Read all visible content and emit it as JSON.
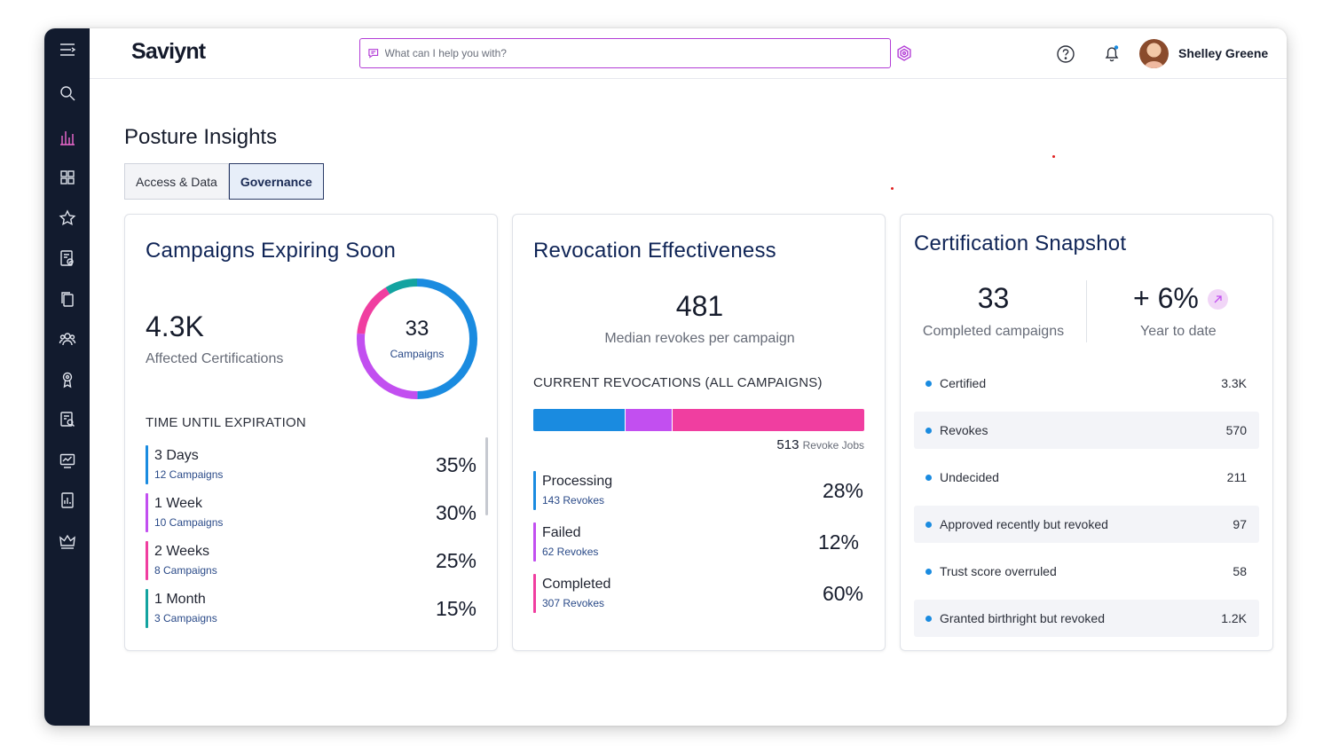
{
  "header": {
    "logo": "Saviynt",
    "search_placeholder": "What can I help you with?",
    "user_name": "Shelley Greene"
  },
  "sidebar": {
    "icons": [
      "menu-icon",
      "search-icon",
      "analytics-icon",
      "dashboard-icon",
      "star-icon",
      "certification-icon",
      "copy-icon",
      "users-icon",
      "award-icon",
      "request-icon",
      "monitor-icon",
      "report-icon",
      "crown-icon"
    ]
  },
  "page": {
    "title": "Posture Insights",
    "tabs": [
      {
        "label": "Access & Data",
        "active": false
      },
      {
        "label": "Governance",
        "active": true
      }
    ]
  },
  "campaigns": {
    "title": "Campaigns Expiring Soon",
    "affected_value": "4.3K",
    "affected_label": "Affected Certifications",
    "donut_value": "33",
    "donut_label": "Campaigns",
    "section_label": "TIME UNTIL EXPIRATION",
    "rows": [
      {
        "label": "3 Days",
        "sub": "12 Campaigns",
        "pct": "35%",
        "color": "#1a8be0"
      },
      {
        "label": "1 Week",
        "sub": "10 Campaigns",
        "pct": "30%",
        "color": "#c24ff0"
      },
      {
        "label": "2 Weeks",
        "sub": "8 Campaigns",
        "pct": "25%",
        "color": "#f03ea0"
      },
      {
        "label": "1 Month",
        "sub": "3 Campaigns",
        "pct": "15%",
        "color": "#13a3a0"
      }
    ]
  },
  "revocation": {
    "title": "Revocation Effectiveness",
    "median_value": "481",
    "median_label": "Median revokes per campaign",
    "section_label": "CURRENT REVOCATIONS (ALL CAMPAIGNS)",
    "jobs_value": "513",
    "jobs_label": "Revoke Jobs",
    "rows": [
      {
        "label": "Processing",
        "sub": "143 Revokes",
        "pct": "28%",
        "color": "#1a8be0"
      },
      {
        "label": "Failed",
        "sub": "62 Revokes",
        "pct": "12%",
        "color": "#c24ff0"
      },
      {
        "label": "Completed",
        "sub": "307 Revokes",
        "pct": "60%",
        "color": "#f03ea0"
      }
    ]
  },
  "certification": {
    "title": "Certification Snapshot",
    "completed_value": "33",
    "completed_label": "Completed campaigns",
    "ytd_value": "+ 6%",
    "ytd_label": "Year to date",
    "stats": [
      {
        "label": "Certified",
        "value": "3.3K"
      },
      {
        "label": "Revokes",
        "value": "570"
      },
      {
        "label": "Undecided",
        "value": "211"
      },
      {
        "label": "Approved recently but revoked",
        "value": "97"
      },
      {
        "label": "Trust score overruled",
        "value": "58"
      },
      {
        "label": "Granted birthright but revoked",
        "value": "1.2K"
      }
    ]
  },
  "colors": {
    "blue": "#1a8be0",
    "purple": "#c24ff0",
    "pink": "#f03ea0",
    "teal": "#13a3a0",
    "navy": "#0f2456",
    "accent": "#b23cd6"
  }
}
